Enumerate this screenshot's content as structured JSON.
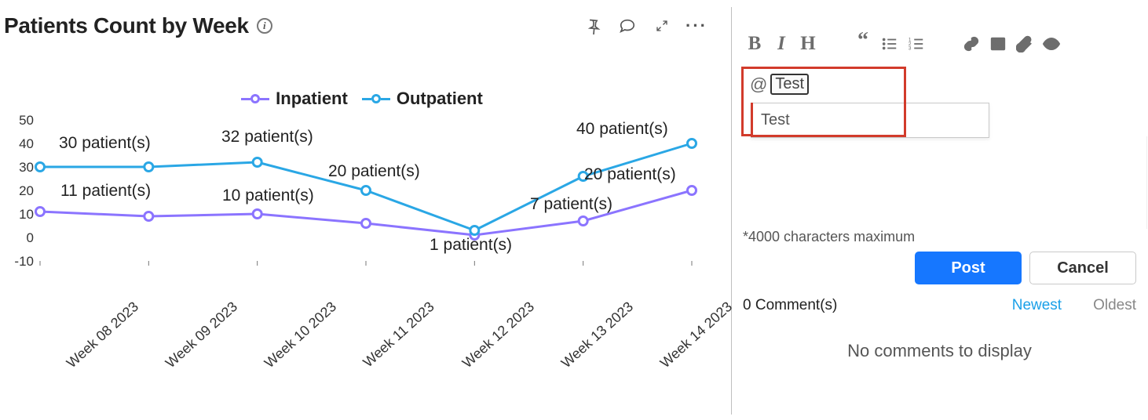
{
  "header": {
    "title": "Patients Count by Week"
  },
  "legend": {
    "inpatient": "Inpatient",
    "outpatient": "Outpatient"
  },
  "chart_data": {
    "type": "line",
    "categories": [
      "Week 08 2023",
      "Week 09 2023",
      "Week 10 2023",
      "Week 11 2023",
      "Week 12 2023",
      "Week 13 2023",
      "Week 14 2023"
    ],
    "series": [
      {
        "name": "Inpatient",
        "color": "#8b74ff",
        "values": [
          11,
          9,
          10,
          6,
          1,
          7,
          20
        ]
      },
      {
        "name": "Outpatient",
        "color": "#2aa7e5",
        "values": [
          30,
          30,
          32,
          20,
          3,
          26,
          40
        ]
      }
    ],
    "y_ticks": [
      -10,
      0,
      10,
      20,
      30,
      40,
      50
    ],
    "ylim": [
      -10,
      50
    ],
    "title": "Patients Count by Week",
    "xlabel": "",
    "ylabel": ""
  },
  "value_labels": {
    "inpatient_w08": "11 patient(s)",
    "inpatient_w10": "10 patient(s)",
    "inpatient_w12": "1 patient(s)",
    "inpatient_w13": "7 patient(s)",
    "inpatient_w14": "20 patient(s)",
    "outpatient_w08": "30 patient(s)",
    "outpatient_w10": "32 patient(s)",
    "outpatient_w11": "20 patient(s)",
    "outpatient_w14": "40 patient(s)"
  },
  "comments": {
    "mention_token": "Test",
    "suggestion": "Test",
    "char_note": "*4000 characters maximum",
    "post_label": "Post",
    "cancel_label": "Cancel",
    "count_label": "0 Comment(s)",
    "newest_label": "Newest",
    "oldest_label": "Oldest",
    "empty_label": "No comments to display"
  }
}
